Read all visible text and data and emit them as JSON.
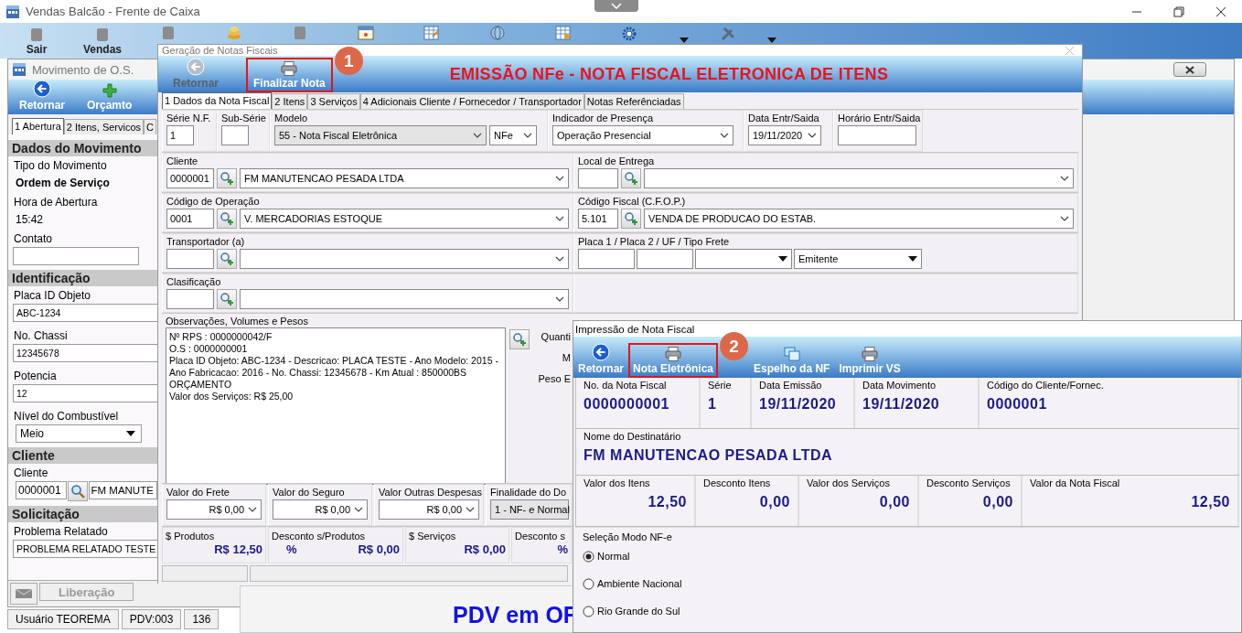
{
  "main_window": {
    "title": "Vendas Balcão - Frente de Caixa",
    "toolbar": [
      {
        "label": "Sair"
      },
      {
        "label": "Vendas"
      }
    ],
    "status_bar": [
      "Usuário TEOREMA",
      "PDV:003",
      "136"
    ],
    "banner": "PDV em OF"
  },
  "os_window": {
    "title": "Movimento de O.S.",
    "toolbar": [
      {
        "label": "Retornar"
      },
      {
        "label": "Orçamto"
      }
    ],
    "tabs": [
      {
        "label": "1 Abertura",
        "selected": true
      },
      {
        "label": "2 Itens, Servicos",
        "selected": false
      },
      {
        "label": "C",
        "selected": false
      }
    ],
    "sections": [
      {
        "heading": "Dados do Movimento",
        "fields": [
          {
            "kind": "label",
            "text": "Tipo do Movimento"
          },
          {
            "kind": "value",
            "text": "Ordem de Serviço"
          },
          {
            "kind": "label",
            "text": "Hora de Abertura"
          },
          {
            "kind": "text",
            "text": "15:42"
          },
          {
            "kind": "label",
            "text": "Contato"
          },
          {
            "kind": "input"
          }
        ]
      },
      {
        "heading": "Identificação",
        "fields": [
          {
            "kind": "label",
            "text": "Placa ID Objeto"
          },
          {
            "kind": "input",
            "value": "ABC-1234"
          },
          {
            "kind": "label",
            "text": "No. Chassi"
          },
          {
            "kind": "input",
            "value": "12345678"
          },
          {
            "kind": "label",
            "text": "Potencia"
          },
          {
            "kind": "input",
            "value": "12"
          },
          {
            "kind": "label",
            "text": "Nível do Combustível"
          },
          {
            "kind": "select",
            "value": "Meio"
          }
        ]
      },
      {
        "heading": "Cliente",
        "fields": [
          {
            "kind": "label",
            "text": "Cliente"
          },
          {
            "kind": "lookup",
            "code": "0000001",
            "name": "FM MANUTE"
          }
        ]
      },
      {
        "heading": "Solicitação",
        "fields": [
          {
            "kind": "label",
            "text": "Problema Relatado"
          },
          {
            "kind": "input",
            "value": "PROBLEMA RELATADO TESTE"
          }
        ]
      }
    ],
    "bottom_buttons": [
      {
        "label": "Liberação",
        "disabled": true
      }
    ]
  },
  "nota_dialog": {
    "title": "Geração de Notas Fiscais",
    "heading": "EMISSÃO NFe - NOTA FISCAL ELETRONICA DE ITENS",
    "toolbar": [
      {
        "label": "Retornar",
        "disabled": true
      },
      {
        "label": "Finalizar Nota",
        "disabled": false,
        "callout": "1"
      }
    ],
    "tabs": [
      {
        "label": "1 Dados da Nota Fiscal",
        "selected": true
      },
      {
        "label": "2 Itens",
        "selected": false
      },
      {
        "label": "3 Serviços",
        "selected": false
      },
      {
        "label": "4 Adicionais Cliente / Fornecedor / Transportador",
        "selected": false
      },
      {
        "label": "Notas Referênciadas",
        "selected": false
      }
    ],
    "header_fields": [
      {
        "kind": "input",
        "label": "Série N.F.",
        "value": "1"
      },
      {
        "kind": "input",
        "label": "Sub-Série"
      },
      {
        "kind": "select_pair",
        "label": "Modelo",
        "value": "55 - Nota Fiscal Eletrônica",
        "value_2": "NFe"
      },
      {
        "kind": "select",
        "label": "Indicador de Presença",
        "value": "Operação Presencial"
      },
      {
        "kind": "select",
        "label": "Data Entr/Saida",
        "value": "19/11/2020"
      },
      {
        "kind": "input",
        "label": "Horário Entr/Saida"
      }
    ],
    "group_rows": [
      [
        {
          "kind": "lookup",
          "label": "Cliente",
          "code": "0000001",
          "name": "FM MANUTENCAO PESADA LTDA"
        },
        {
          "kind": "lookup",
          "label": "Local de Entrega"
        }
      ],
      [
        {
          "kind": "lookup",
          "label": "Código de Operação",
          "code": "0001",
          "name": "V. MERCADORIAS ESTOQUE"
        },
        {
          "kind": "lookup",
          "label": "Código Fiscal (C.F.O.P.)",
          "code": "5.101",
          "name": "VENDA DE PRODUCAO DO ESTAB."
        }
      ],
      [
        {
          "kind": "lookup",
          "label": "Transportador (a)"
        },
        {
          "kind": "plates",
          "label": "Placa 1 / Placa 2 / UF / Tipo Frete",
          "freight": "Emitente"
        }
      ],
      [
        {
          "kind": "lookup",
          "label": "Clasificação"
        }
      ]
    ],
    "notes": {
      "label": "Observações, Volumes e Pesos",
      "lines": [
        "Nº RPS : 0000000042/F",
        "O.S : 0000000001",
        "Placa ID Objeto: ABC-1234 - Descricao: PLACA TESTE - Ano Modelo: 2015 -",
        "Ano Fabricacao: 2016 - No. Chassi: 12345678 - Km Atual : 850000BS",
        "ORÇAMENTO",
        "Valor dos Serviços: R$ 25,00"
      ],
      "side_labels": [
        "Quanti",
        "M",
        "Peso E"
      ]
    },
    "charges": [
      {
        "kind": "money",
        "label": "Valor do Frete",
        "value": "R$ 0,00"
      },
      {
        "kind": "money",
        "label": "Valor do Seguro",
        "value": "R$ 0,00"
      },
      {
        "kind": "money",
        "label": "Valor Outras Despesas",
        "value": "R$ 0,00"
      },
      {
        "kind": "select",
        "label": "Finalidade do Do",
        "value": "1 - NF- e Normal"
      }
    ],
    "totals": [
      {
        "label": "$ Produtos",
        "values": [
          "R$ 12,50"
        ]
      },
      {
        "label": "Desconto s/Produtos",
        "values": [
          "%",
          "R$ 0,00"
        ]
      },
      {
        "label": "$ Serviços",
        "values": [
          "R$ 0,00"
        ]
      },
      {
        "label": "Desconto s",
        "values": [
          "%"
        ]
      }
    ]
  },
  "print_dialog": {
    "title": "Impressão de Nota Fiscal",
    "toolbar": [
      {
        "label": "Retornar"
      },
      {
        "label": "Nota Eletrônica",
        "callout": "2"
      },
      {
        "label": "Espelho da NF"
      },
      {
        "label": "Imprimir VS"
      }
    ],
    "info_rows": [
      [
        {
          "label": "No. da Nota Fiscal",
          "value": "0000000001"
        },
        {
          "label": "Série",
          "value": "1"
        },
        {
          "label": "Data Emissão",
          "value": "19/11/2020"
        },
        {
          "label": "Data Movimento",
          "value": "19/11/2020"
        },
        {
          "label": "Código do Cliente/Fornec.",
          "value": "0000001"
        }
      ],
      [
        {
          "label": "Nome do Destinatário",
          "value": "FM MANUTENCAO PESADA LTDA"
        }
      ],
      [
        {
          "label": "Valor dos Itens",
          "value": "12,50"
        },
        {
          "label": "Desconto Itens",
          "value": "0,00"
        },
        {
          "label": "Valor dos Serviços",
          "value": "0,00"
        },
        {
          "label": "Desconto Serviços",
          "value": "0,00"
        },
        {
          "label": "Valor da Nota Fiscal",
          "value": "12,50"
        }
      ]
    ],
    "mode": {
      "label": "Seleção Modo NF-e",
      "options": [
        {
          "label": "Normal",
          "selected": true
        },
        {
          "label": "Ambiente Nacional",
          "selected": false
        },
        {
          "label": "Rio Grande do Sul",
          "selected": false
        }
      ]
    }
  }
}
